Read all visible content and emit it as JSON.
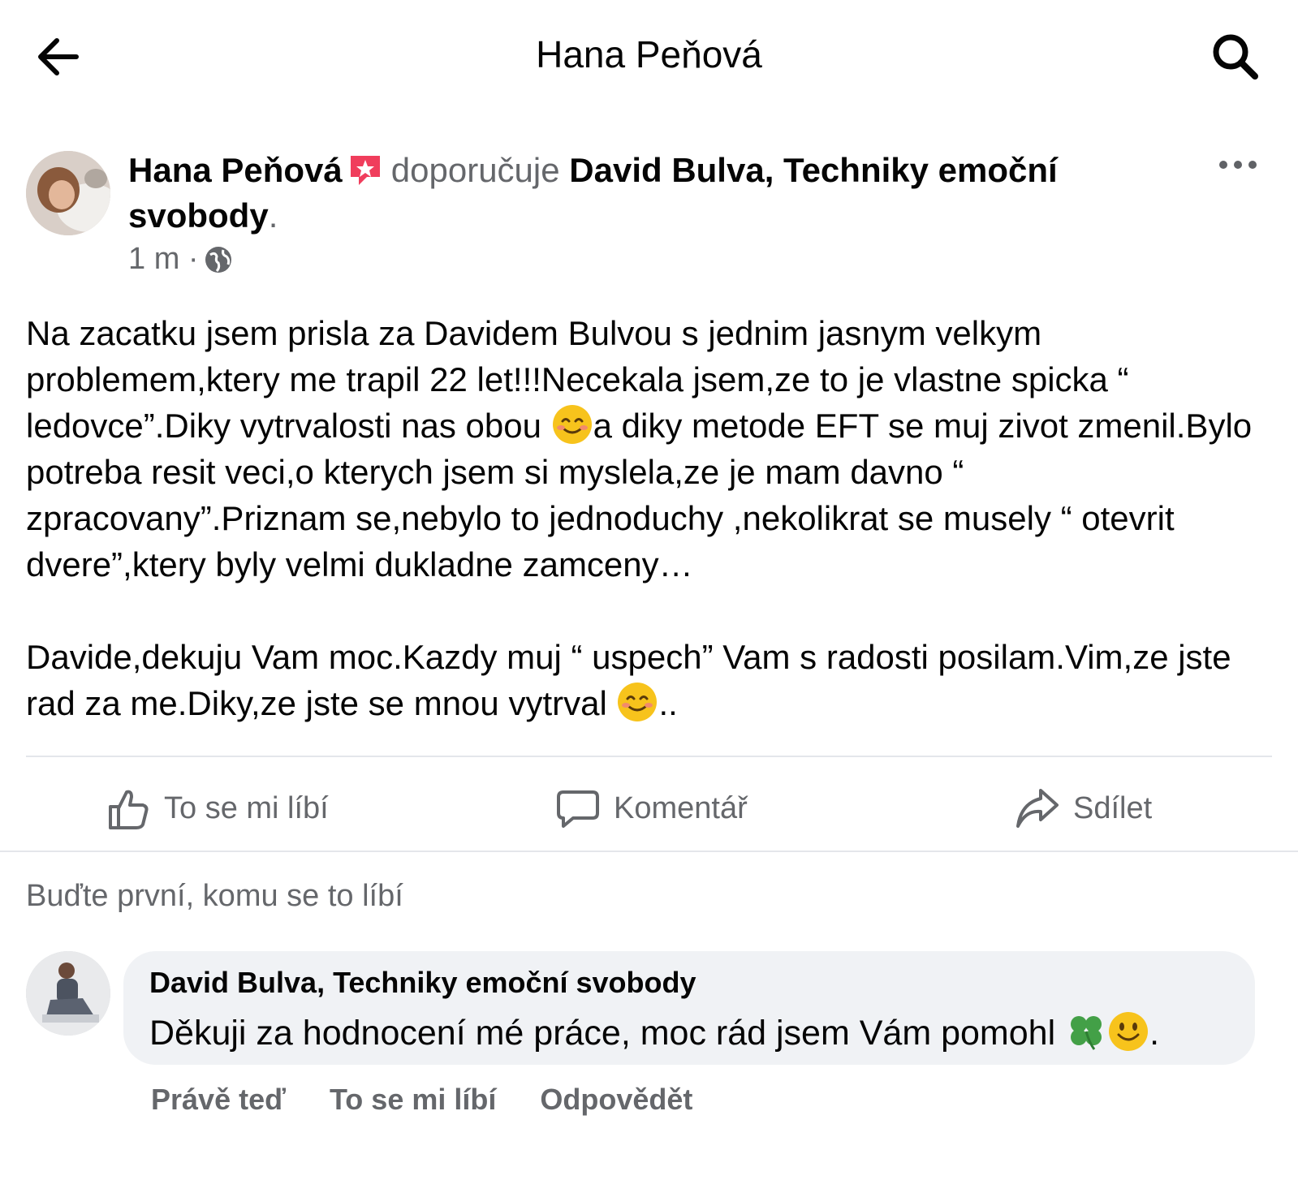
{
  "header": {
    "title": "Hana Peňová"
  },
  "post": {
    "author": "Hana Peňová",
    "action_word": "doporučuje",
    "target": "David Bulva, Techniky emoční svobody",
    "target_period": ".",
    "time": "1 m",
    "dot": "·",
    "paragraph1_a": "Na zacatku jsem prisla za Davidem Bulvou s jednim jasnym velkym problemem,ktery me trapil 22 let!!!Necekala jsem,ze to je vlastne spicka “ ledovce”.Diky vytrvalosti nas obou ",
    "paragraph1_b": "a diky metode EFT se muj zivot zmenil.Bylo potreba resit veci,o kterych jsem si myslela,ze je mam davno “ zpracovany”.Priznam se,nebylo to jednoduchy ,nekolikrat se musely “ otevrit dvere”,ktery byly velmi dukladne zamceny…",
    "paragraph2_a": "Davide,dekuju Vam moc.Kazdy muj “ uspech” Vam s radosti posilam.Vim,ze jste rad za me.Diky,ze jste se mnou vytrval ",
    "paragraph2_b": ".."
  },
  "actions": {
    "like": "To se mi líbí",
    "comment": "Komentář",
    "share": "Sdílet"
  },
  "first_like": "Buďte první, komu se to líbí",
  "comment": {
    "author": "David Bulva, Techniky emoční svobody",
    "text": "Děkuji za hodnocení mé práce,  moc rád jsem Vám pomohl ",
    "text_end": ".",
    "time": "Právě teď",
    "like": "To se mi líbí",
    "reply": "Odpovědět"
  },
  "icons": [
    "back-arrow-icon",
    "search-icon",
    "more-icon",
    "recommend-icon",
    "globe-icon",
    "like-icon",
    "comment-icon",
    "share-icon",
    "smile-emoji",
    "clover-emoji"
  ]
}
